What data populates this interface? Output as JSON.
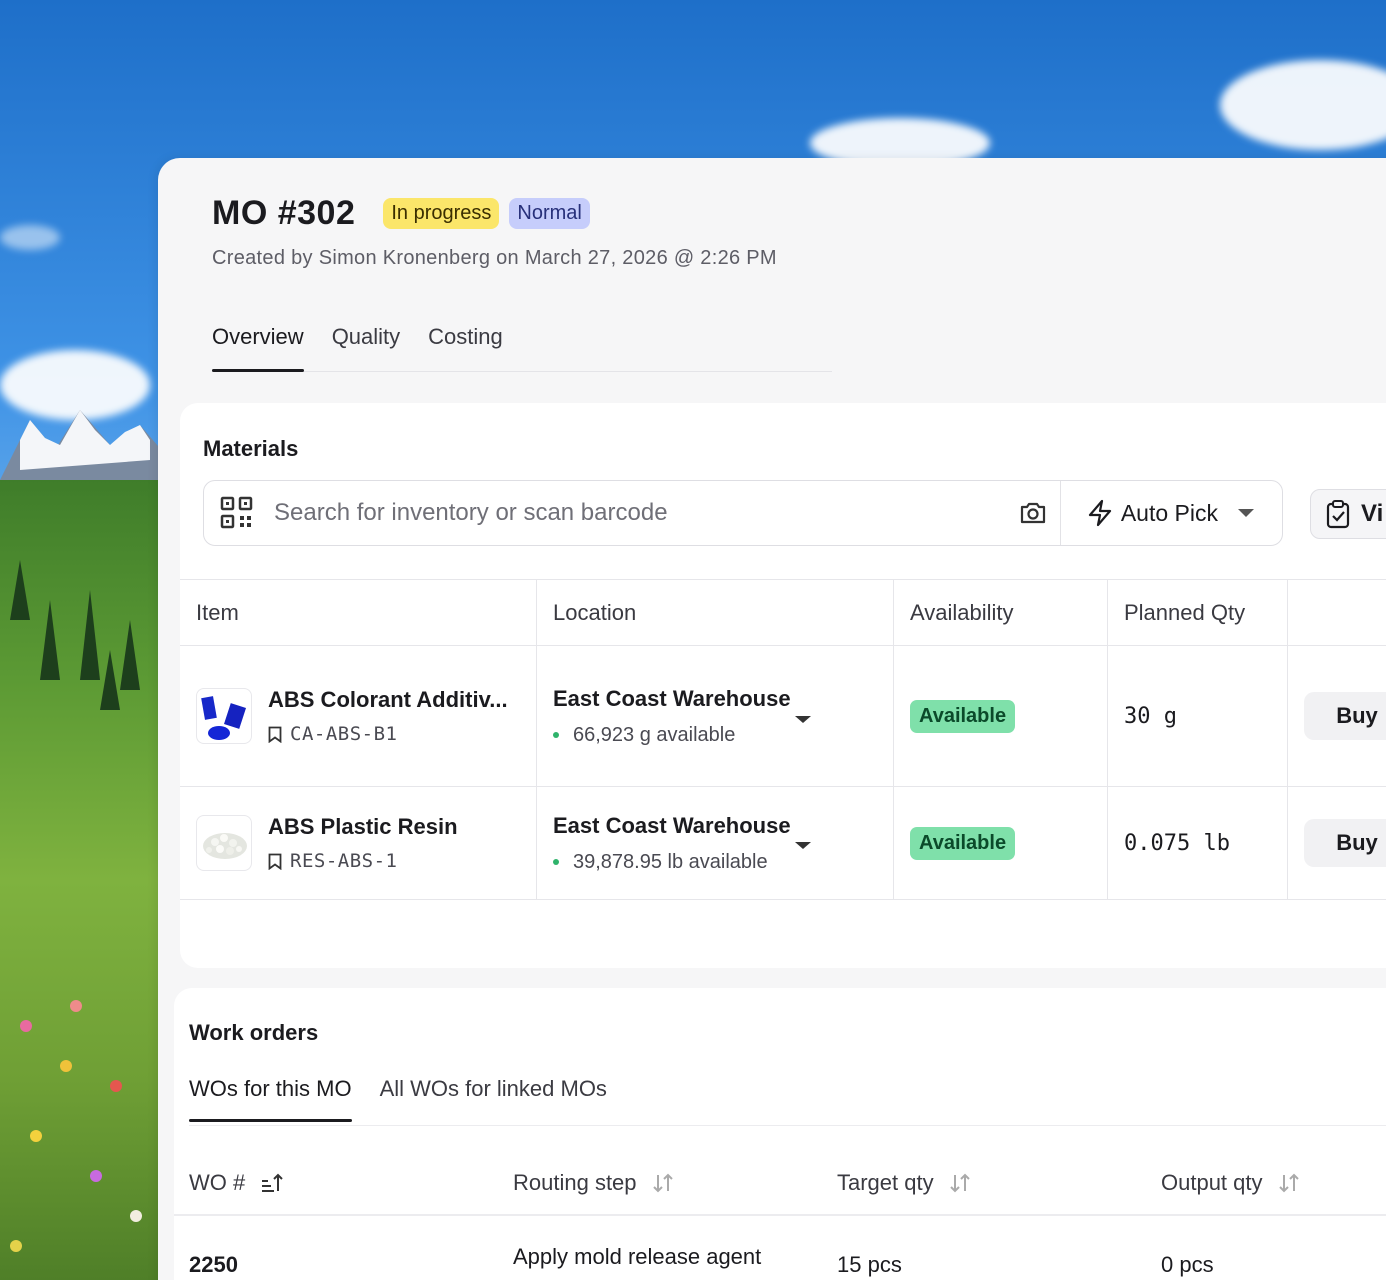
{
  "header": {
    "title": "MO #302",
    "status_badge": "In progress",
    "priority_badge": "Normal",
    "subtitle": "Created by Simon Kronenberg on March 27, 2026 @ 2:26 PM"
  },
  "tabs": [
    "Overview",
    "Quality",
    "Costing"
  ],
  "materials": {
    "title": "Materials",
    "search_placeholder": "Search for inventory or scan barcode",
    "auto_pick_label": "Auto Pick",
    "view_label": "Vi",
    "columns": [
      "Item",
      "Location",
      "Availability",
      "Planned Qty"
    ],
    "rows": [
      {
        "name": "ABS Colorant Additiv...",
        "sku": "CA-ABS-B1",
        "location": "East Coast Warehouse",
        "location_available": "66,923 g available",
        "availability": "Available",
        "planned_qty": "30 g",
        "action": "Buy"
      },
      {
        "name": "ABS Plastic Resin",
        "sku": "RES-ABS-1",
        "location": "East Coast Warehouse",
        "location_available": "39,878.95 lb available",
        "availability": "Available",
        "planned_qty": "0.075 lb",
        "action": "Buy"
      }
    ]
  },
  "work_orders": {
    "title": "Work orders",
    "tabs": [
      "WOs for this MO",
      "All WOs for linked MOs"
    ],
    "columns": [
      "WO #",
      "Routing step",
      "Target qty",
      "Output qty"
    ],
    "rows": [
      {
        "wo": "2250",
        "step": "Apply mold release agent",
        "target": "15 pcs",
        "output": "0 pcs"
      }
    ]
  },
  "colors": {
    "in_progress": "#fbe66a",
    "normal": "#c6cdfb",
    "available": "#7fe0aa"
  }
}
